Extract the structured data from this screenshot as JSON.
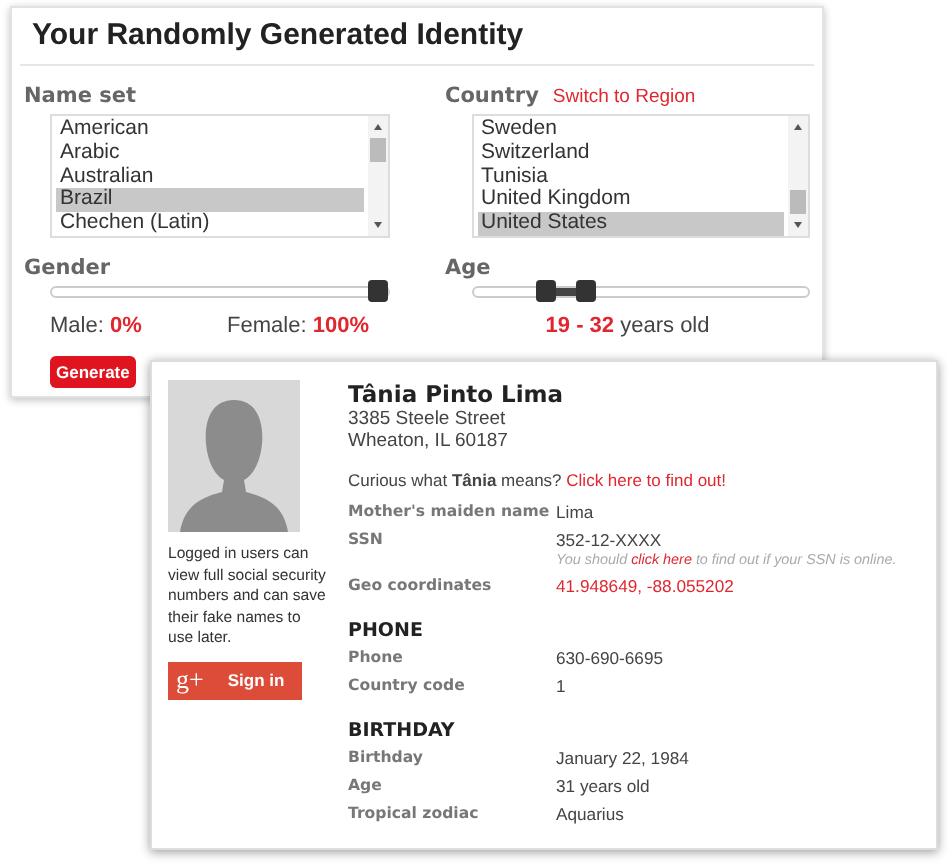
{
  "title": "Your Randomly Generated Identity",
  "name_set": {
    "label": "Name set",
    "options": [
      {
        "label": "American",
        "selected": false
      },
      {
        "label": "Arabic",
        "selected": false
      },
      {
        "label": "Australian",
        "selected": false
      },
      {
        "label": "Brazil",
        "selected": true
      },
      {
        "label": "Chechen (Latin)",
        "selected": false
      }
    ]
  },
  "country": {
    "label": "Country",
    "link": "Switch to Region",
    "options": [
      {
        "label": "Sweden",
        "selected": false
      },
      {
        "label": "Switzerland",
        "selected": false
      },
      {
        "label": "Tunisia",
        "selected": false
      },
      {
        "label": "United Kingdom",
        "selected": false
      },
      {
        "label": "United States",
        "selected": true
      }
    ]
  },
  "gender": {
    "label": "Gender",
    "level": 1,
    "male_label": "Male:",
    "male_value": "0%",
    "female_label": "Female:",
    "female_value": "100%"
  },
  "age": {
    "label": "Age",
    "thumbs": [
      {
        "level": 0.2
      },
      {
        "level": 0.33
      }
    ],
    "min": "19",
    "separator": "-",
    "max": "32",
    "suffix": "years old"
  },
  "generate_button": "Generate",
  "identity": {
    "name": "Tânia Pinto Lima",
    "address": [
      "3385 Steele Street",
      "Wheaton, IL 60187"
    ],
    "curious": "Curious what **Tânia** means?",
    "curious_link": "Click here to find out!",
    "login_note": "Logged in users can view full social security numbers and can save their fake names to use later.",
    "signin_button": {
      "icon": "g+",
      "label": "Sign in"
    },
    "sections": [
      {
        "rows": [
          {
            "kind": "text",
            "label": "Mother's maiden name",
            "value": "Lima"
          },
          {
            "kind": "note",
            "label": "SSN",
            "value": "352-12-XXXX",
            "note_before": "You should",
            "note_link": "click here",
            "note_after": "to find out if your SSN is online."
          },
          {
            "kind": "link",
            "label": "Geo coordinates",
            "value": "41.948649, -88.055202"
          }
        ]
      },
      {
        "heading": "PHONE",
        "rows": [
          {
            "kind": "text",
            "label": "Phone",
            "value": "630-690-6695"
          },
          {
            "kind": "text",
            "label": "Country code",
            "value": "1"
          }
        ]
      },
      {
        "heading": "BIRTHDAY",
        "rows": [
          {
            "kind": "text",
            "label": "Birthday",
            "value": "January 22, 1984"
          },
          {
            "kind": "text",
            "label": "Age",
            "value": "31 years old"
          },
          {
            "kind": "text",
            "label": "Tropical zodiac",
            "value": "Aquarius"
          }
        ]
      }
    ]
  }
}
